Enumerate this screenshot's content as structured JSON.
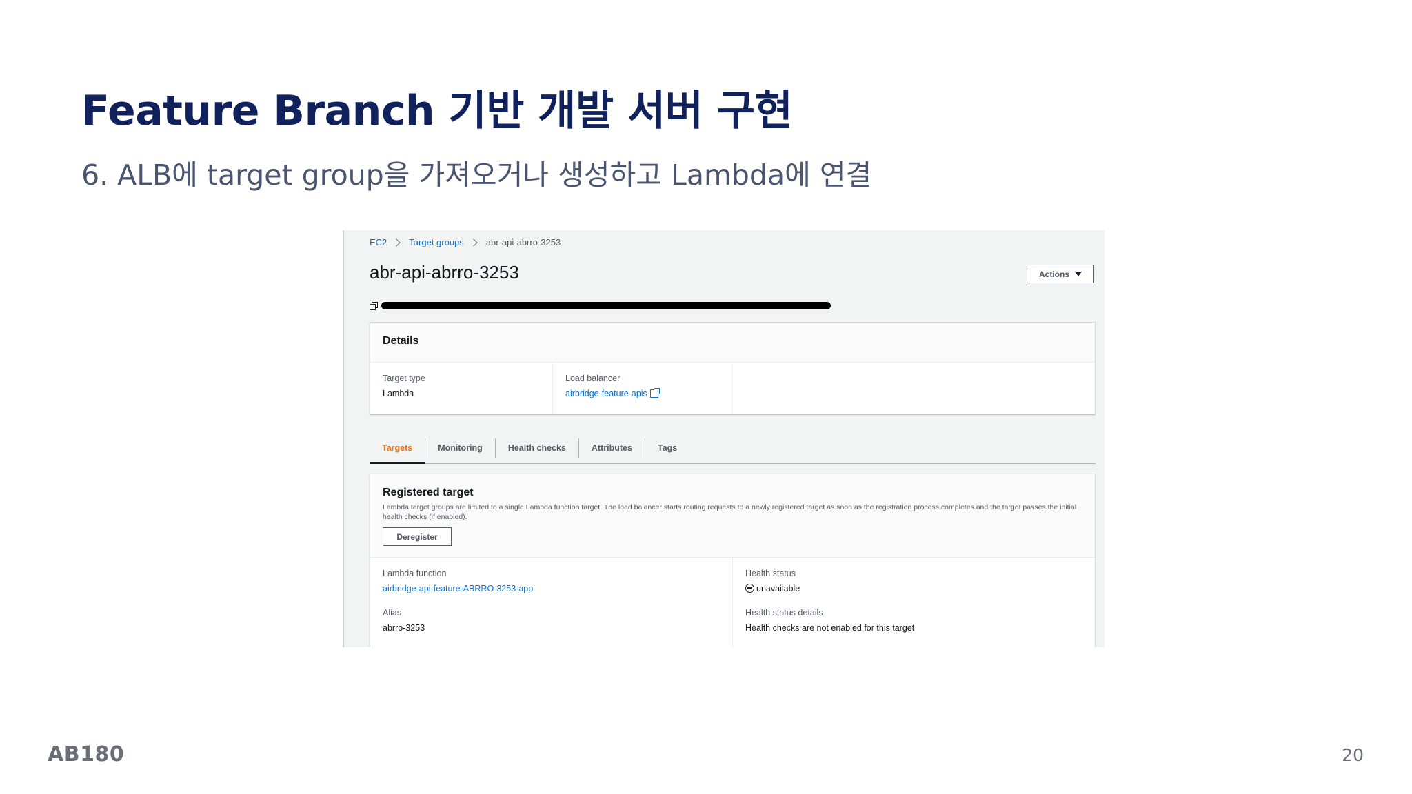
{
  "slide": {
    "title": "Feature Branch 기반 개발 서버 구현",
    "subtitle": "6. ALB에 target group을 가져오거나 생성하고 Lambda에 연결",
    "brand": "AB180",
    "page_number": "20"
  },
  "console": {
    "breadcrumbs": [
      "EC2",
      "Target groups",
      "abr-api-abrro-3253"
    ],
    "title": "abr-api-abrro-3253",
    "actions_label": "Actions",
    "details": {
      "header": "Details",
      "target_type_label": "Target type",
      "target_type_value": "Lambda",
      "load_balancer_label": "Load balancer",
      "load_balancer_value": "airbridge-feature-apis"
    },
    "tabs": [
      "Targets",
      "Monitoring",
      "Health checks",
      "Attributes",
      "Tags"
    ],
    "registered": {
      "title": "Registered target",
      "description": "Lambda target groups are limited to a single Lambda function target. The load balancer starts routing requests to a newly registered target as soon as the registration process completes and the target passes the initial health checks (if enabled).",
      "deregister_label": "Deregister",
      "lambda_function_label": "Lambda function",
      "lambda_function_value": "airbridge-api-feature-ABRRO-3253-app",
      "alias_label": "Alias",
      "alias_value": "abrro-3253",
      "health_status_label": "Health status",
      "health_status_value": "unavailable",
      "health_details_label": "Health status details",
      "health_details_value": "Health checks are not enabled for this target"
    }
  },
  "colors": {
    "title": "#10215c",
    "link": "#0972d3",
    "active_tab": "#ec7211"
  }
}
